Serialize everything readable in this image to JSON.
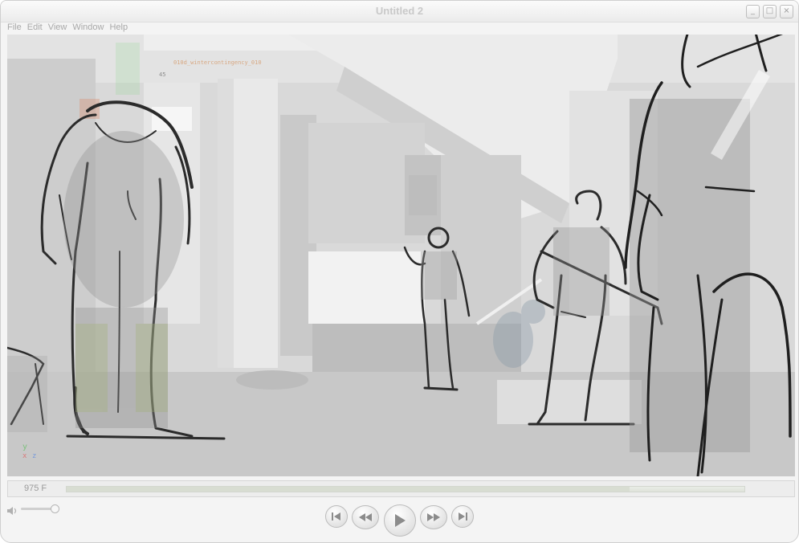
{
  "window": {
    "title": "Untitled 2",
    "buttons": {
      "minimize": "_",
      "maximize": "□",
      "close": "×"
    }
  },
  "menu": [
    "File",
    "Edit",
    "View",
    "Window",
    "Help"
  ],
  "viewport": {
    "hud_name": "010d_wintercontingency_010",
    "hud_number": "45",
    "axis_y": "y",
    "axis_x": "x",
    "axis_z": "z"
  },
  "timeline": {
    "frame_label": "975 F",
    "progress": 0.83
  },
  "controls": {
    "volume_level": 0.95,
    "icons": [
      "speaker-icon",
      "skip-back-icon",
      "rewind-icon",
      "play-icon",
      "fast-forward-icon",
      "skip-forward-icon"
    ]
  }
}
